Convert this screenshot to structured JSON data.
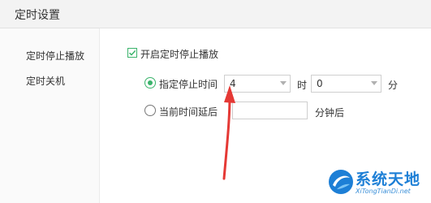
{
  "dialog": {
    "title": "定时设置"
  },
  "sidebar": {
    "items": [
      {
        "label": "定时停止播放"
      },
      {
        "label": "定时关机"
      }
    ]
  },
  "settings": {
    "enable_checkbox": {
      "label": "开启定时停止播放",
      "checked": true
    },
    "option_specific_time": {
      "label": "指定停止时间",
      "selected": true,
      "hour_value": "4",
      "hour_unit": "时",
      "minute_value": "0",
      "minute_unit": "分"
    },
    "option_delay": {
      "label": "当前时间延后",
      "selected": false,
      "minutes_value": "",
      "unit": "分钟后"
    }
  },
  "annotation": {
    "arrow_color": "#e53935"
  },
  "colors": {
    "accent": "#3ab36b",
    "watermark_blue": "#1d7fd6"
  },
  "watermark": {
    "main": "系统天地",
    "sub": "XiTongTianDi.net"
  }
}
